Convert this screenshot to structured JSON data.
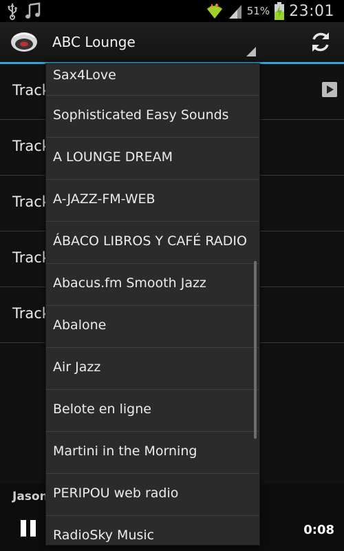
{
  "status_bar": {
    "battery_percent": "51%",
    "time": "23:01",
    "icons": [
      "usb-icon",
      "music-note-icon",
      "wifi-icon",
      "signal-icon",
      "battery-charging-icon"
    ]
  },
  "action_bar": {
    "selected_station": "ABC Lounge",
    "accent_color": "#33a5d6"
  },
  "tracks": [
    {
      "label": "Track"
    },
    {
      "label": "Track"
    },
    {
      "label": "Track"
    },
    {
      "label": "Track"
    },
    {
      "label": "Track"
    }
  ],
  "player": {
    "now_playing": "Jason",
    "elapsed": "0:08"
  },
  "dropdown": {
    "items": [
      "Sax4Love",
      "Sophisticated Easy Sounds",
      "A LOUNGE DREAM",
      "A-JAZZ-FM-WEB",
      "ÁBACO LIBROS Y CAFÉ RADIO",
      "Abacus.fm Smooth Jazz",
      "Abalone",
      "Air Jazz",
      "Belote en ligne",
      "Martini in the Morning",
      "PERIPOU web radio",
      "RadioSky Music"
    ]
  }
}
